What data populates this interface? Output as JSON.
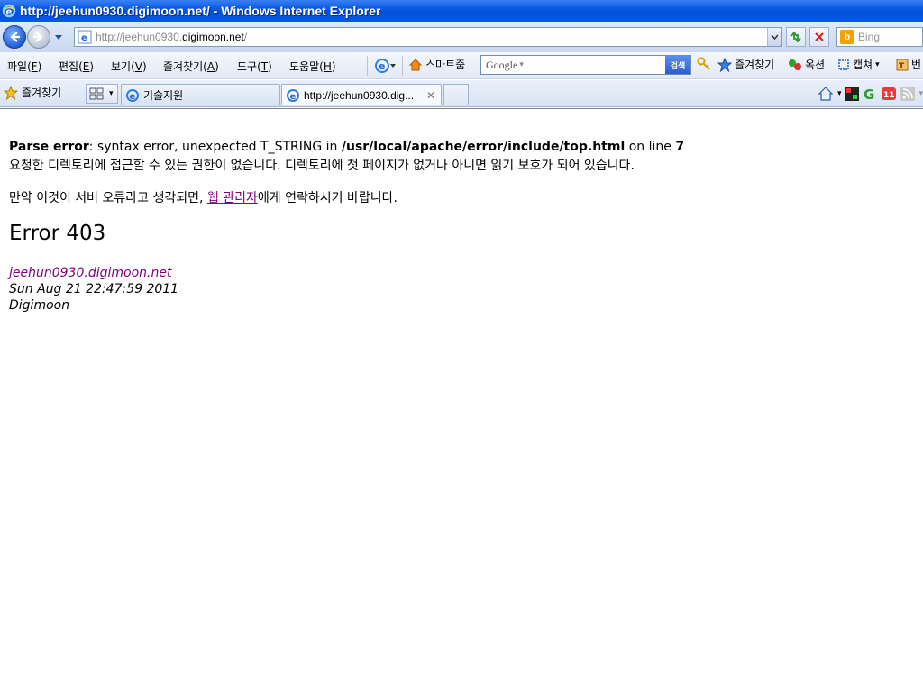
{
  "window": {
    "title": "http://jeehun0930.digimoon.net/ - Windows Internet Explorer"
  },
  "address_bar": {
    "url_prefix": "http://jeehun0930.",
    "url_host": "digimoon.net",
    "url_suffix": "/"
  },
  "search": {
    "placeholder": "Bing"
  },
  "menu": {
    "items": [
      {
        "label": "파일(",
        "key": "F",
        "suffix": ")"
      },
      {
        "label": "편집(",
        "key": "E",
        "suffix": ")"
      },
      {
        "label": "보기(",
        "key": "V",
        "suffix": ")"
      },
      {
        "label": "즐겨찾기(",
        "key": "A",
        "suffix": ")"
      },
      {
        "label": "도구(",
        "key": "T",
        "suffix": ")"
      },
      {
        "label": "도움말(",
        "key": "H",
        "suffix": ")"
      }
    ]
  },
  "toolbar": {
    "smart_zoom": "스마트줌",
    "google_logo": "Google",
    "google_search": "검색",
    "favorites": "즐겨찾기",
    "options": "옥션",
    "capture": "캡쳐",
    "translate": "번"
  },
  "favorites_bar": {
    "label": "즐겨찾기"
  },
  "tabs": [
    {
      "label": "기술지원",
      "active": false
    },
    {
      "label": "http://jeehun0930.dig...",
      "active": true
    }
  ],
  "page": {
    "parse_error_label": "Parse error",
    "parse_error_text1": ": syntax error, unexpected T_STRING in ",
    "parse_error_path": "/usr/local/apache/error/include/top.html",
    "parse_error_text2": " on line ",
    "parse_error_line": "7",
    "message1": "요청한 디렉토리에 접근할 수 있는 권한이 없습니다. 디렉토리에 첫 페이지가 없거나 아니면 읽기 보호가 되어 있습니다.",
    "message2_prefix": "만약 이것이 서버 오류라고 생각되면, ",
    "message2_link": "웹 관리자",
    "message2_suffix": "에게 연락하시기 바랍니다.",
    "error_heading": "Error 403",
    "host_link": "jeehun0930.digimoon.net",
    "timestamp": "Sun Aug 21 22:47:59 2011",
    "server_name": "Digimoon"
  },
  "colors": {
    "titlebar": "#0a5ae0",
    "link_visited": "#800080"
  }
}
